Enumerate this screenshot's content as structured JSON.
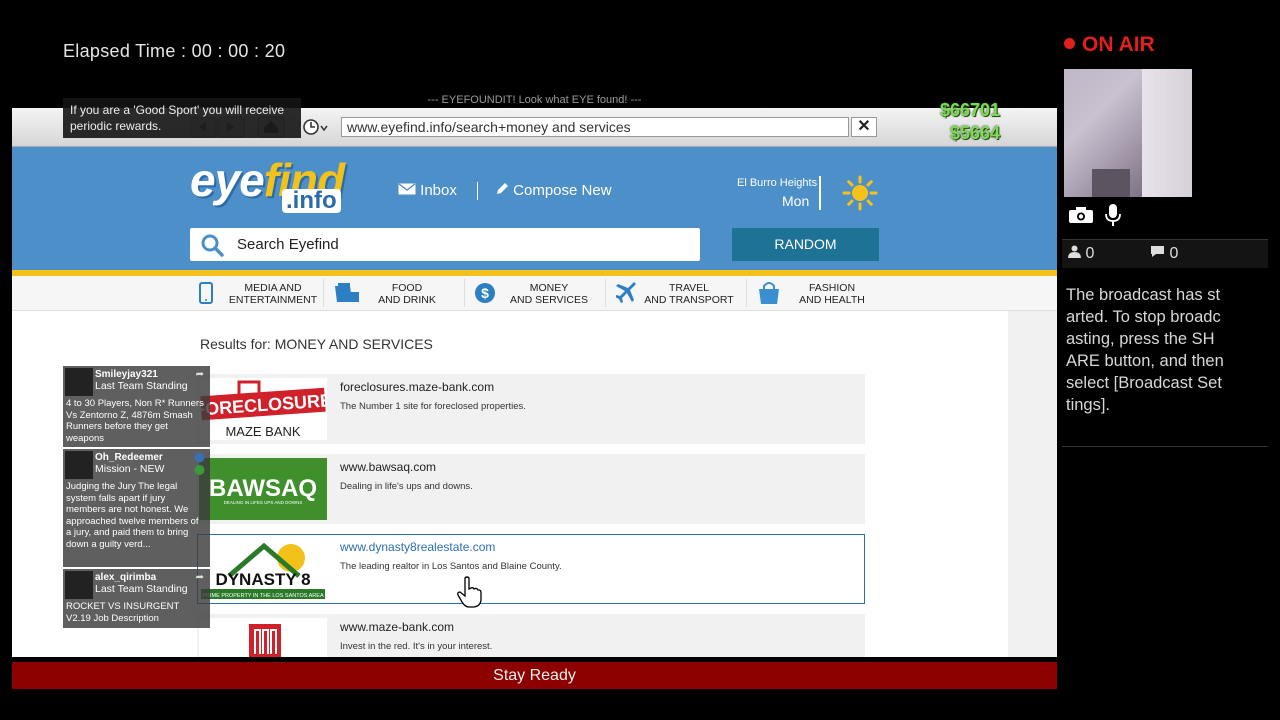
{
  "stream": {
    "elapsed_label": "Elapsed Time :",
    "elapsed_value": "00 : 00 : 20"
  },
  "broadcast": {
    "on_air": "ON AIR",
    "viewers": "0",
    "comments": "0",
    "message": "The broadcast has started. To stop broadcasting, press the SHARE button, and then select [Broadcast Settings]."
  },
  "hud": {
    "tip": "If you are a 'Good Sport' you will receive periodic rewards.",
    "cash_bank": "$66701",
    "cash_wallet": "$5664",
    "status_bar": "Stay Ready"
  },
  "browser": {
    "banner": "--- EYEFOUNDIT! Look what EYE found! ---",
    "url": "www.eyefind.info/search+money and services",
    "close_label": "✕"
  },
  "site": {
    "logo_main_a": "eye",
    "logo_main_b": "find",
    "logo_sub": ".info",
    "inbox": "Inbox",
    "compose": "Compose New",
    "location": "El Burro Heights",
    "day": "Mon",
    "search_placeholder": "Search Eyefind",
    "random": "RANDOM",
    "categories": [
      {
        "line1": "MEDIA AND",
        "line2": "ENTERTAINMENT"
      },
      {
        "line1": "FOOD",
        "line2": "AND DRINK"
      },
      {
        "line1": "MONEY",
        "line2": "AND SERVICES"
      },
      {
        "line1": "TRAVEL",
        "line2": "AND TRANSPORT"
      },
      {
        "line1": "FASHION",
        "line2": "AND HEALTH"
      }
    ],
    "results_title": "Results for: MONEY AND SERVICES",
    "results": [
      {
        "url": "foreclosures.maze-bank.com",
        "desc": "The Number 1 site for foreclosed properties.",
        "logo_text1": "FORECLOSURE",
        "logo_text2": "MAZE BANK"
      },
      {
        "url": "www.bawsaq.com",
        "desc": "Dealing in life's ups and downs.",
        "logo_text1": "BAWSAQ",
        "logo_text2": "DEALING IN LIFES UPS AND DOWNS"
      },
      {
        "url": "www.dynasty8realestate.com",
        "desc": "The leading realtor in Los Santos and Blaine County.",
        "logo_text1": "DYNASTY 8",
        "logo_text2": "PRIME PROPERTY IN THE LOS SANTOS AREA"
      },
      {
        "url": "www.maze-bank.com",
        "desc": "Invest in the red. It's in your interest."
      }
    ]
  },
  "jobs": [
    {
      "user": "Smileyjay321",
      "mode": "Last Team Standing",
      "body": "4 to 30 Players, Non R* Runners Vs Zentorno Z, 4876m Smash Runners before they get weapons"
    },
    {
      "user": "Oh_Redeemer",
      "mode": "Mission - NEW",
      "body": "Judging the Jury The legal system falls apart if jury members are not honest. We approached twelve members of a jury, and paid them to bring down a guilty verd..."
    },
    {
      "user": "alex_qirimba",
      "mode": "Last Team Standing",
      "body": "ROCKET VS INSURGENT V2.19 Job Description"
    }
  ],
  "colors": {
    "site_blue": "#4d8fc9",
    "accent_yellow": "#f2c21a",
    "random_button": "#1d7296",
    "on_air_red": "#e0201c",
    "status_bar_red": "#8c0000",
    "cash_green": "#7ed957"
  }
}
